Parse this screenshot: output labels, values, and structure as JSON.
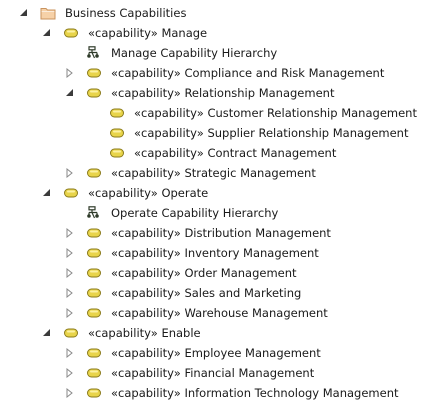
{
  "tree": {
    "nodes": [
      {
        "label": "Business Capabilities",
        "icon": "folder-icon",
        "level": 0,
        "toggle": "expanded"
      },
      {
        "label": "«capability» Manage",
        "icon": "capability-icon",
        "level": 1,
        "toggle": "expanded"
      },
      {
        "label": "Manage Capability Hierarchy",
        "icon": "diagram-icon",
        "level": 2,
        "toggle": "none"
      },
      {
        "label": "«capability» Compliance and Risk Management",
        "icon": "capability-icon",
        "level": 2,
        "toggle": "collapsed"
      },
      {
        "label": "«capability» Relationship Management",
        "icon": "capability-icon",
        "level": 2,
        "toggle": "expanded"
      },
      {
        "label": "«capability» Customer Relationship Management",
        "icon": "capability-icon",
        "level": 3,
        "toggle": "none"
      },
      {
        "label": "«capability» Supplier Relationship Management",
        "icon": "capability-icon",
        "level": 3,
        "toggle": "none"
      },
      {
        "label": "«capability» Contract Management",
        "icon": "capability-icon",
        "level": 3,
        "toggle": "none"
      },
      {
        "label": "«capability» Strategic Management",
        "icon": "capability-icon",
        "level": 2,
        "toggle": "collapsed"
      },
      {
        "label": "«capability» Operate",
        "icon": "capability-icon",
        "level": 1,
        "toggle": "expanded"
      },
      {
        "label": "Operate Capability Hierarchy",
        "icon": "diagram-icon",
        "level": 2,
        "toggle": "none"
      },
      {
        "label": "«capability» Distribution Management",
        "icon": "capability-icon",
        "level": 2,
        "toggle": "collapsed"
      },
      {
        "label": "«capability» Inventory Management",
        "icon": "capability-icon",
        "level": 2,
        "toggle": "collapsed"
      },
      {
        "label": "«capability» Order Management",
        "icon": "capability-icon",
        "level": 2,
        "toggle": "collapsed"
      },
      {
        "label": "«capability» Sales and Marketing",
        "icon": "capability-icon",
        "level": 2,
        "toggle": "collapsed"
      },
      {
        "label": "«capability» Warehouse Management",
        "icon": "capability-icon",
        "level": 2,
        "toggle": "collapsed"
      },
      {
        "label": "«capability» Enable",
        "icon": "capability-icon",
        "level": 1,
        "toggle": "expanded"
      },
      {
        "label": "«capability» Employee Management",
        "icon": "capability-icon",
        "level": 2,
        "toggle": "collapsed"
      },
      {
        "label": "«capability» Financial Management",
        "icon": "capability-icon",
        "level": 2,
        "toggle": "collapsed"
      },
      {
        "label": "«capability» Information Technology Management",
        "icon": "capability-icon",
        "level": 2,
        "toggle": "collapsed"
      }
    ]
  },
  "colors": {
    "folder_fill": "#f6d1a8",
    "folder_stroke": "#c9935e",
    "capability_fill": "#e8d44a",
    "capability_stroke": "#8a7a1a",
    "diagram_stroke": "#2f3b2a",
    "toggle_expanded": "#3b3b3b",
    "toggle_collapsed": "#8a8a8a",
    "text": "#1a1a1a"
  }
}
